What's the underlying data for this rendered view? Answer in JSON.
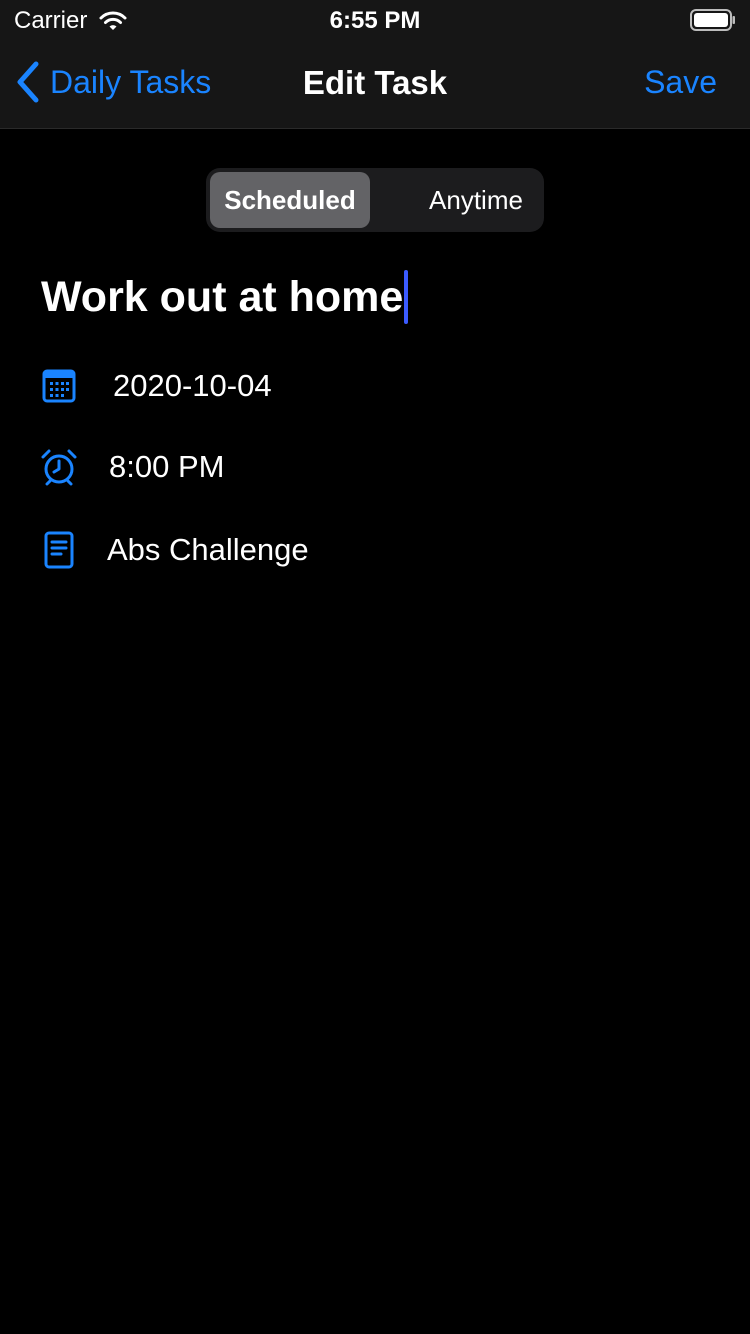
{
  "status_bar": {
    "carrier": "Carrier",
    "time": "6:55 PM",
    "wifi_icon": "wifi-icon",
    "battery_icon": "battery-icon"
  },
  "nav": {
    "back_label": "Daily Tasks",
    "back_icon": "chevron-left-icon",
    "title": "Edit Task",
    "save_label": "Save"
  },
  "segmented": {
    "options": [
      "Scheduled",
      "Anytime"
    ],
    "selected": "Scheduled"
  },
  "task": {
    "title": "Work out at home"
  },
  "details": {
    "date": {
      "icon": "calendar-icon",
      "value": "2020-10-04"
    },
    "time": {
      "icon": "alarm-clock-icon",
      "value": "8:00 PM"
    },
    "note": {
      "icon": "note-icon",
      "value": "Abs Challenge"
    }
  },
  "colors": {
    "accent": "#1a84ff",
    "background": "#000000",
    "bar_background": "#161616",
    "segment_selected": "#636366",
    "caret": "#3b5bff"
  }
}
